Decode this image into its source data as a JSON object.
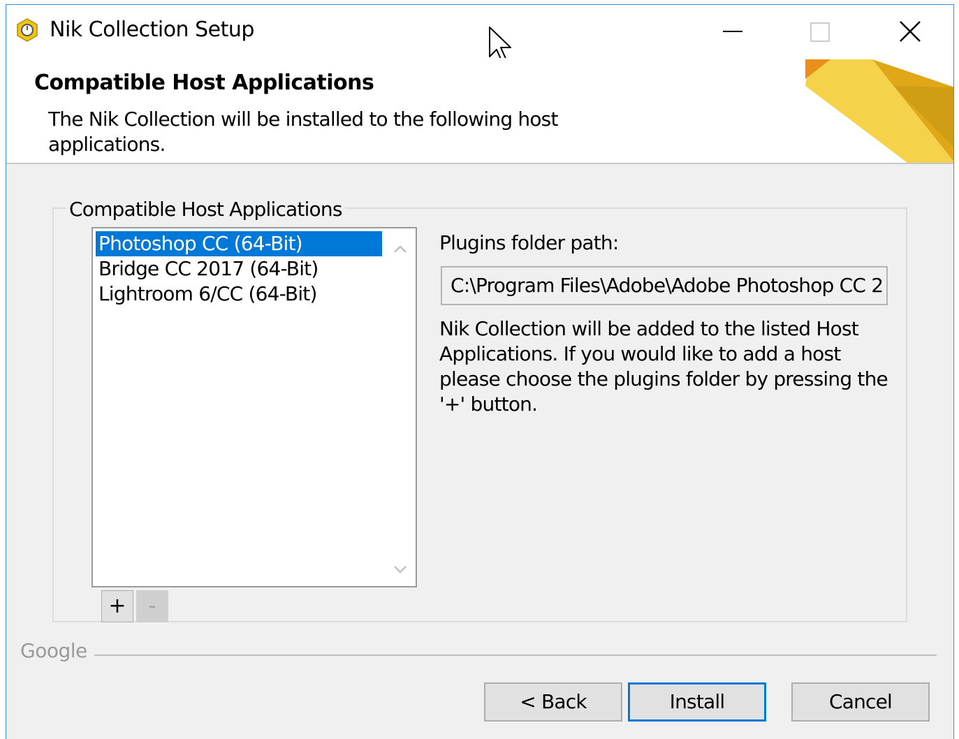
{
  "window": {
    "title": "Nik Collection Setup"
  },
  "header": {
    "title": "Compatible Host Applications",
    "description": "The Nik Collection will be installed to the following host applications."
  },
  "group": {
    "legend": "Compatible Host Applications",
    "host_list": {
      "items": [
        {
          "label": "Photoshop CC (64-Bit)",
          "selected": true
        },
        {
          "label": "Bridge CC 2017 (64-Bit)",
          "selected": false
        },
        {
          "label": "Lightroom 6/CC (64-Bit)",
          "selected": false
        }
      ]
    },
    "add_label": "+",
    "remove_label": "-",
    "plugins_folder_label": "Plugins folder path:",
    "plugins_folder_value": "C:\\Program Files\\Adobe\\Adobe Photoshop CC 2",
    "info_text": "Nik Collection will be added to the listed Host Applications. If you would like to add a host please choose the plugins folder by pressing the '+' button."
  },
  "footer": {
    "brand": "Google",
    "back_label": "< Back",
    "install_label": "Install",
    "cancel_label": "Cancel"
  },
  "colors": {
    "selection": "#0078d7",
    "window_border": "#3b8ad9",
    "accent_yellow": "#f0c419"
  },
  "icons": {
    "app": "nik-collection-icon",
    "minimize": "minimize-icon",
    "maximize": "maximize-icon",
    "close": "close-icon",
    "cursor": "mouse-pointer-icon"
  }
}
